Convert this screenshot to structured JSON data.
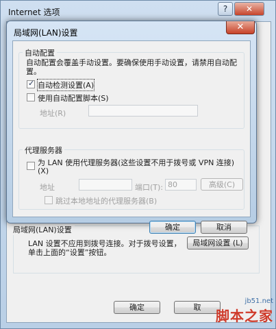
{
  "back_window": {
    "title": "Internet 选项",
    "help_label": "?",
    "close_label": "✕",
    "lan_group_legend": "局域网(LAN)设置",
    "lan_text": "LAN 设置不应用到拨号连接。对于拨号设置，单击上面的“设置”按钮。",
    "lan_settings_button": "局域网设置 (L)",
    "ok_label": "确定",
    "cancel_label": "取"
  },
  "dialog": {
    "title": "局域网(LAN)设置",
    "close_label": "✕",
    "auto_config": {
      "legend": "自动配置",
      "description": "自动配置会覆盖手动设置。要确保使用手动设置，请禁用自动配置。",
      "auto_detect": {
        "label": "自动检测设置(A)",
        "checked": true
      },
      "use_script": {
        "label": "使用自动配置脚本(S)",
        "checked": false
      },
      "address_label": "地址(R)",
      "address_value": ""
    },
    "proxy": {
      "legend": "代理服务器",
      "use_proxy": {
        "label": "为 LAN 使用代理服务器(这些设置不用于拨号或 VPN 连接)(X)",
        "checked": false
      },
      "address_label": "地址",
      "address_value": "",
      "port_label": "端口(T):",
      "port_value": "80",
      "advanced_label": "高级(C)",
      "bypass": {
        "label": "跳过本地地址的代理服务器(B)",
        "checked": false
      }
    },
    "ok_label": "确定",
    "cancel_label": "取消"
  },
  "watermark": {
    "url": "jb51.net",
    "logo": "脚本之家"
  }
}
